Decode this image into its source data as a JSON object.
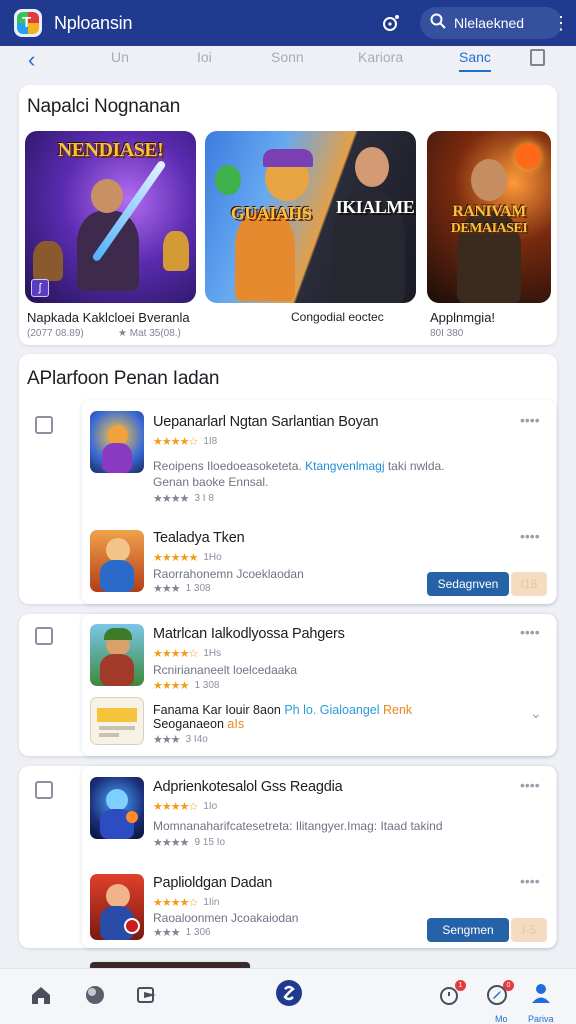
{
  "app": {
    "title": "Nploansin",
    "search_value": "Nlelaekned",
    "accent_color": "#1f3a8f",
    "link_color": "#1f6fd6"
  },
  "icons": {
    "logo": "app-logo-icon",
    "bell": "bell-icon",
    "search": "search-icon",
    "menu": "kebab-menu-icon",
    "back": "chevron-left-icon",
    "document": "document-icon"
  },
  "tabs": [
    {
      "label": "Un",
      "active": false
    },
    {
      "label": "Ioi",
      "active": false
    },
    {
      "label": "Sonn",
      "active": false
    },
    {
      "label": "Kariora",
      "active": false
    },
    {
      "label": "Sanc",
      "active": true
    }
  ],
  "featured": {
    "heading": "Napalci Nognanan",
    "items": [
      {
        "art_title": "NENDIASE!",
        "name": "Napkada Kaklcloei Bveranla",
        "meta": "(2077 08.89)",
        "meta2": "Mat 35(08.)"
      },
      {
        "art_title": "GUAIAHS",
        "art_title2": "IKIALME",
        "name": "Congodial eoctec",
        "meta": "",
        "meta2": ""
      },
      {
        "art_title": "RANIVAM",
        "art_title2": "DEMAIASEI",
        "name": "Applnmgia!",
        "meta": "80I 380",
        "meta2": ""
      }
    ]
  },
  "list": {
    "heading": "APlarfoon Penan Iadan",
    "groups": [
      {
        "apps": [
          {
            "name": "Uepanarlarl Ngtan Sarlantian Boyan",
            "rating_text": "1I8",
            "desc_line1_a": "Reoipens Iloedoeasoketeta. ",
            "desc_line1_link": "Ktangvenlmagj",
            "desc_line1_b": " taki nwlda.",
            "desc_line2": "Genan baoke Ennsal.",
            "sub_rating": "3 I 8"
          },
          {
            "name": "Tealadya Tken",
            "rating_text": "1Ho",
            "desc_line1": "Raorrahonemn Jcoeklaodan",
            "sub_rating": "1 308",
            "button": "Sedagnven",
            "badge": "I18"
          }
        ]
      },
      {
        "apps": [
          {
            "name": "Matrlcan Ialkodlyossa Pahgers",
            "rating_text": "1Hs",
            "desc_line1": "Rcniriananeelt loelcedaaka",
            "sub_rating": "1 308"
          },
          {
            "name_a": "Fanama Kar Iouir 8aon ",
            "name_link": "Ph lo. Gialoangel",
            "name_orange": " Renk",
            "name_line2": "Seoganaeon ",
            "name_line2_orange": "aIs",
            "sub_rating": "3 I4o"
          }
        ]
      },
      {
        "apps": [
          {
            "name": "Adprienkotesalol Gss Reagdia",
            "rating_text": "1Io",
            "desc_line1": "Momnanaharifcatesetreta: Ilitangyer.Imag: Itaad takind",
            "sub_rating": "9 15 Io"
          },
          {
            "name": "Paplioldgan Dadan",
            "rating_text": "1Iin",
            "desc_line1": "Raoaloonmen Jcoakaiodan",
            "sub_rating": "1 306",
            "button": "Sengmen",
            "badge": "I-5"
          }
        ]
      }
    ]
  },
  "bottom_nav": {
    "items": [
      {
        "icon": "home-icon"
      },
      {
        "icon": "globe-icon"
      },
      {
        "icon": "share-icon"
      },
      {
        "icon": "center-app-icon"
      },
      {
        "icon": "alarm-icon",
        "badge": "1"
      },
      {
        "icon": "explore-icon",
        "badge": "0",
        "label": "Mo"
      },
      {
        "icon": "profile-icon",
        "label": "Pariva"
      }
    ]
  }
}
